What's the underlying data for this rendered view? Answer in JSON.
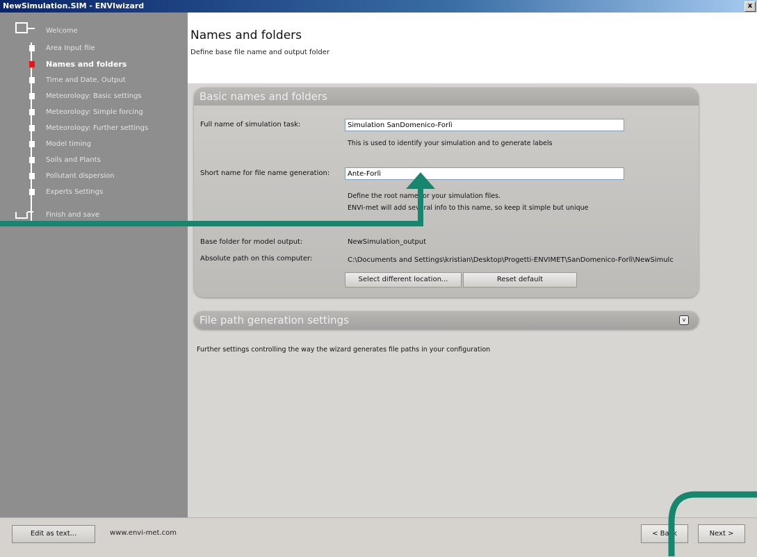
{
  "window": {
    "title": "NewSimulation.SIM - ENVIwizard",
    "close_label": "x"
  },
  "sidebar": {
    "root_label": "Welcome",
    "steps": [
      {
        "label": "Area Input file",
        "active": false
      },
      {
        "label": "Names and folders",
        "active": true
      },
      {
        "label": "Time and Date, Output",
        "active": false
      },
      {
        "label": "Meteorology: Basic settings",
        "active": false
      },
      {
        "label": "Meteorology: Simple forcing",
        "active": false
      },
      {
        "label": "Meteorology: Further settings",
        "active": false
      },
      {
        "label": "Model timing",
        "active": false
      },
      {
        "label": "Soils and Plants",
        "active": false
      },
      {
        "label": "Pollutant dispersion",
        "active": false
      },
      {
        "label": "Experts Settings",
        "active": false
      }
    ],
    "finish_label": "Finish and save",
    "active_color": "#e8141a"
  },
  "header": {
    "title": "Names and folders",
    "subtitle": "Define base file name and output folder"
  },
  "basic_panel": {
    "title": "Basic names and folders",
    "full_name_label": "Full name of simulation task:",
    "full_name_value": "Simulation SanDomenico-Forlì",
    "full_name_hint": "This is used to identify your simulation and to generate labels",
    "short_name_label": "Short name for file name generation:",
    "short_name_value": "Ante-Forlì",
    "short_name_hint_1": "Define the root name for your simulation files.",
    "short_name_hint_2": "ENVI-met will add several info to this name, so keep it simple but unique",
    "base_folder_label": "Base folder for model output:",
    "base_folder_value": "NewSimulation_output",
    "abs_path_label": "Absolute path on this computer:",
    "abs_path_value": "C:\\Documents and Settings\\kristian\\Desktop\\Progetti-ENVIMET\\SanDomenico-Forlì\\NewSimulc",
    "select_location_label": "Select different location...",
    "reset_default_label": "Reset default"
  },
  "filepath_panel": {
    "title": "File path generation settings",
    "expand_icon": "chevron-down-icon",
    "expand_glyph": "v",
    "description": "Further settings controlling the way the wizard generates file paths in your configuration"
  },
  "footer": {
    "edit_text_label": "Edit as text...",
    "website": "www.envi-met.com",
    "back_label": "< Back",
    "next_label": "Next >"
  },
  "annotation": {
    "color": "#16866e"
  }
}
